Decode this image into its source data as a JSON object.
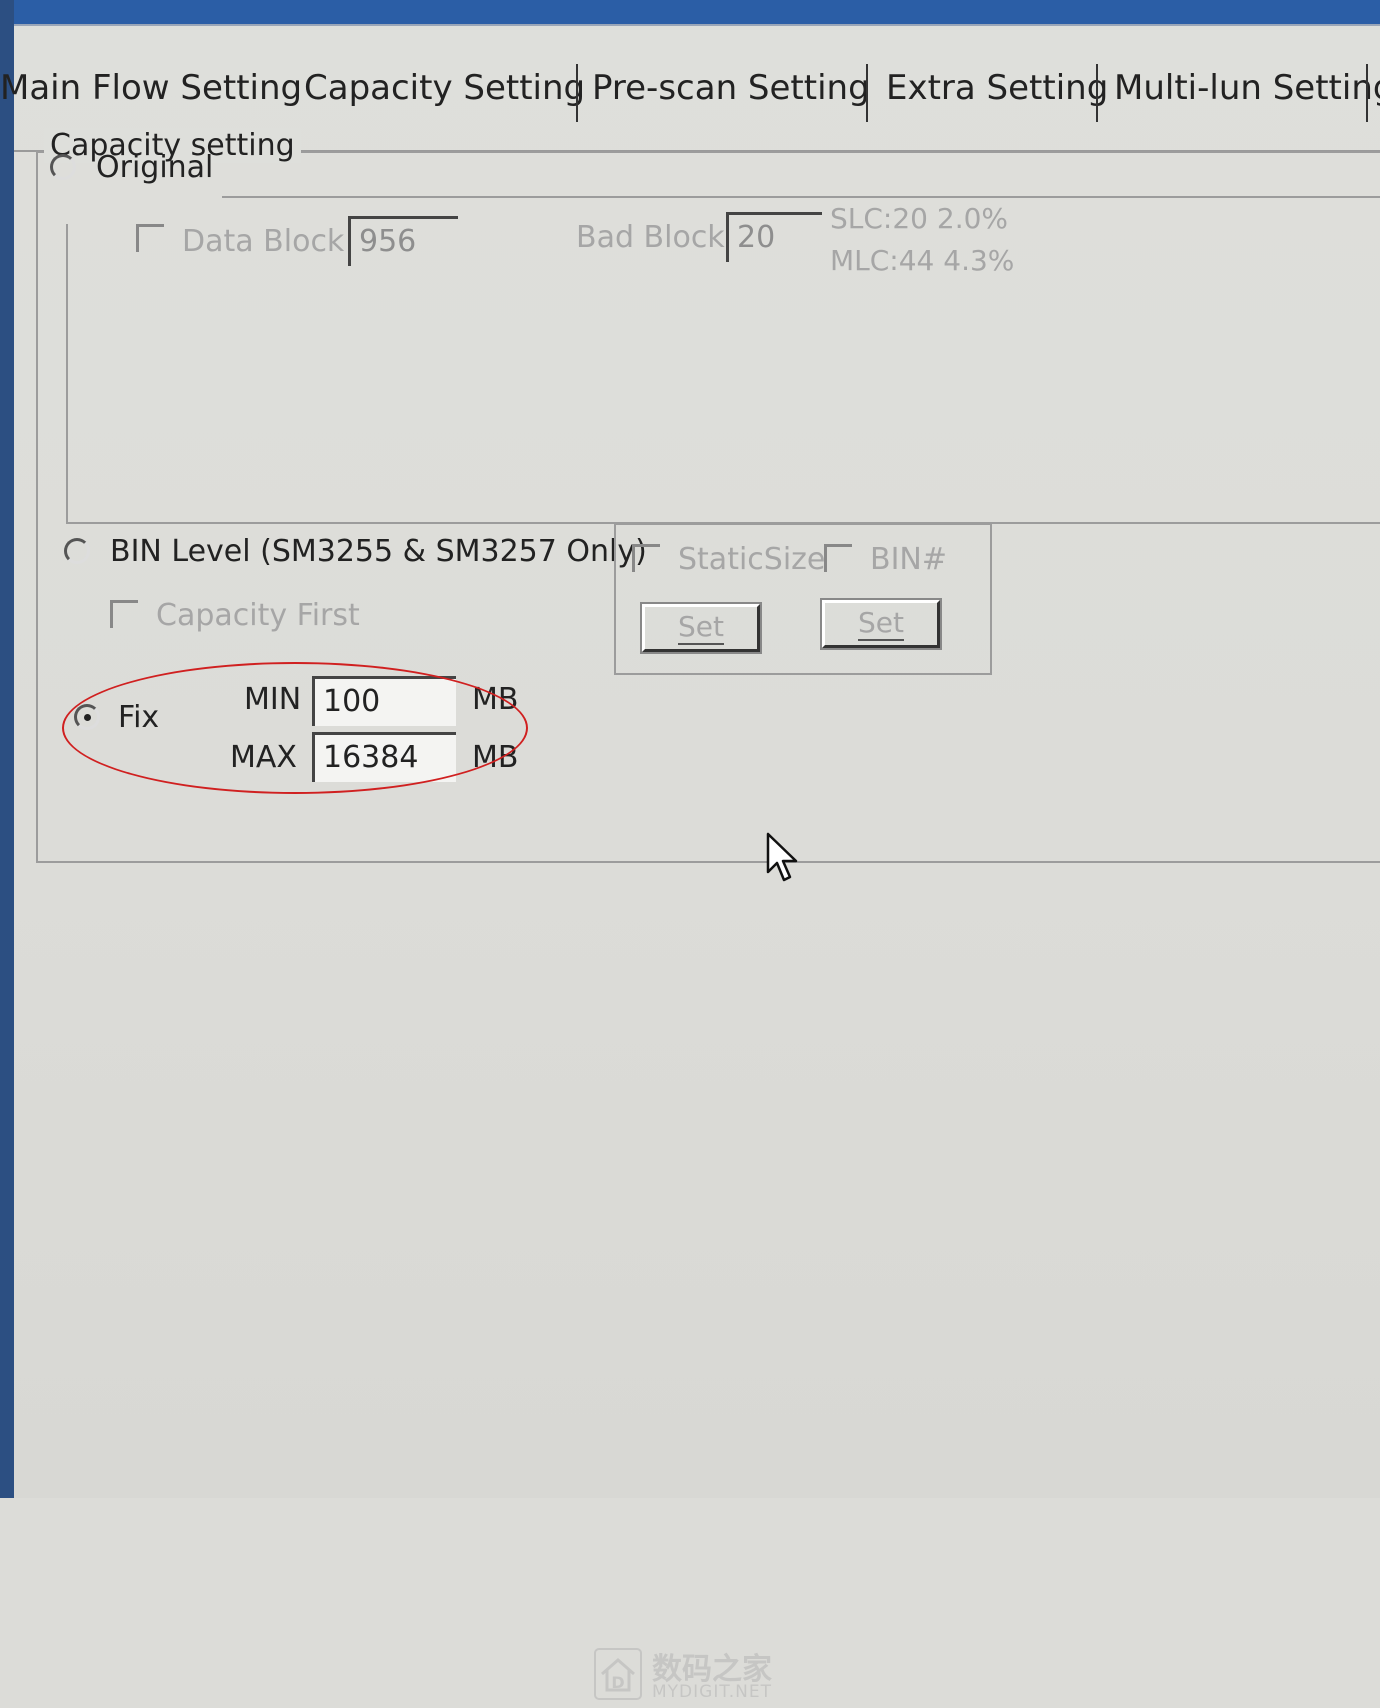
{
  "tabs": [
    {
      "label": "Main Flow Setting"
    },
    {
      "label": "Capacity Setting"
    },
    {
      "label": "Pre-scan Setting"
    },
    {
      "label": "Extra Setting"
    },
    {
      "label": "Multi-lun Setting"
    }
  ],
  "capacity": {
    "group_title": "Capacity setting",
    "original": {
      "label": "Original",
      "data_block_label": "Data Block",
      "data_block_value": "956",
      "bad_block_label": "Bad Block",
      "bad_block_value": "20",
      "slc_text": "SLC:20 2.0%",
      "mlc_text": "MLC:44 4.3%"
    },
    "bin_level": {
      "label": "BIN Level (SM3255 & SM3257 Only)",
      "capacity_first_label": "Capacity First",
      "static_size_label": "StaticSize",
      "binx_label": "BIN#",
      "set_button_1": "Set",
      "set_button_2": "Set"
    },
    "fix": {
      "label": "Fix",
      "min_label": "MIN",
      "min_value": "100",
      "min_unit": "MB",
      "max_label": "MAX",
      "max_value": "16384",
      "max_unit": "MB"
    }
  },
  "watermark": {
    "cn": "数码之家",
    "en": "MYDIGIT.NET"
  },
  "colors": {
    "annotation_ellipse": "#d02020",
    "panel_bg": "#dcdcd8"
  }
}
